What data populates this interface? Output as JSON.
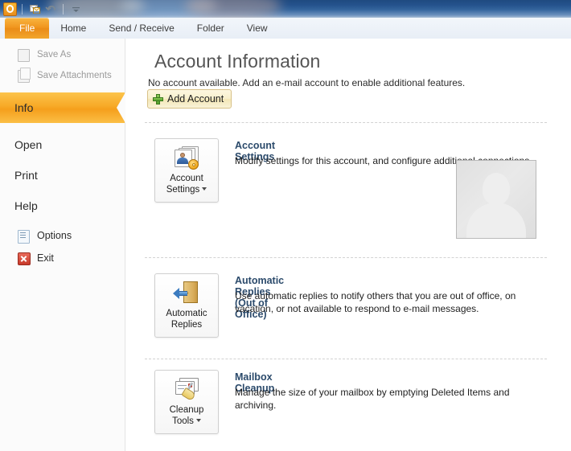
{
  "titlebar": {
    "quick_access": [
      {
        "name": "outlook-logo",
        "label": "O"
      },
      {
        "name": "send-receive-all",
        "label": ""
      },
      {
        "name": "undo",
        "label": ""
      },
      {
        "name": "customize-qat",
        "label": ""
      }
    ]
  },
  "ribbon": {
    "tabs": [
      {
        "label": "File",
        "selected": true
      },
      {
        "label": "Home",
        "selected": false
      },
      {
        "label": "Send / Receive",
        "selected": false
      },
      {
        "label": "Folder",
        "selected": false
      },
      {
        "label": "View",
        "selected": false
      }
    ]
  },
  "sidebar": {
    "items": [
      {
        "label": "Save As",
        "state": "disabled",
        "icon": "save-as-icon"
      },
      {
        "label": "Save Attachments",
        "state": "disabled",
        "icon": "save-attachments-icon"
      },
      {
        "label": "Info",
        "state": "selected",
        "icon": ""
      },
      {
        "label": "Open",
        "state": "normal",
        "icon": ""
      },
      {
        "label": "Print",
        "state": "normal",
        "icon": ""
      },
      {
        "label": "Help",
        "state": "normal",
        "icon": ""
      },
      {
        "label": "Options",
        "state": "normal",
        "icon": "options-icon"
      },
      {
        "label": "Exit",
        "state": "normal",
        "icon": "exit-icon"
      }
    ]
  },
  "content": {
    "title": "Account Information",
    "no_account_message": "No account available. Add an e-mail account to enable additional features.",
    "add_account_label": "Add Account",
    "sections": [
      {
        "button_label_line1": "Account",
        "button_label_line2": "Settings",
        "has_caret": true,
        "heading": "Account Settings",
        "description": "Modify settings for this account, and configure additional connections.",
        "icon": "account-settings-icon"
      },
      {
        "button_label_line1": "Automatic",
        "button_label_line2": "Replies",
        "has_caret": false,
        "heading": "Automatic Replies (Out of Office)",
        "description": "Use automatic replies to notify others that you are out of office, on vacation, or not available to respond to e-mail messages.",
        "icon": "automatic-replies-icon"
      },
      {
        "button_label_line1": "Cleanup",
        "button_label_line2": "Tools",
        "has_caret": true,
        "heading": "Mailbox Cleanup",
        "description": "Manage the size of your mailbox by emptying Deleted Items and archiving.",
        "icon": "cleanup-tools-icon"
      }
    ],
    "avatar_alt": "contact-photo-placeholder"
  },
  "colors": {
    "accent_orange": "#f5a01c",
    "file_tab": "#ef9018",
    "titlebar_blue": "#24528c",
    "heading_blue": "#2b4a6b",
    "add_account_bg": "#f8f0cd"
  }
}
